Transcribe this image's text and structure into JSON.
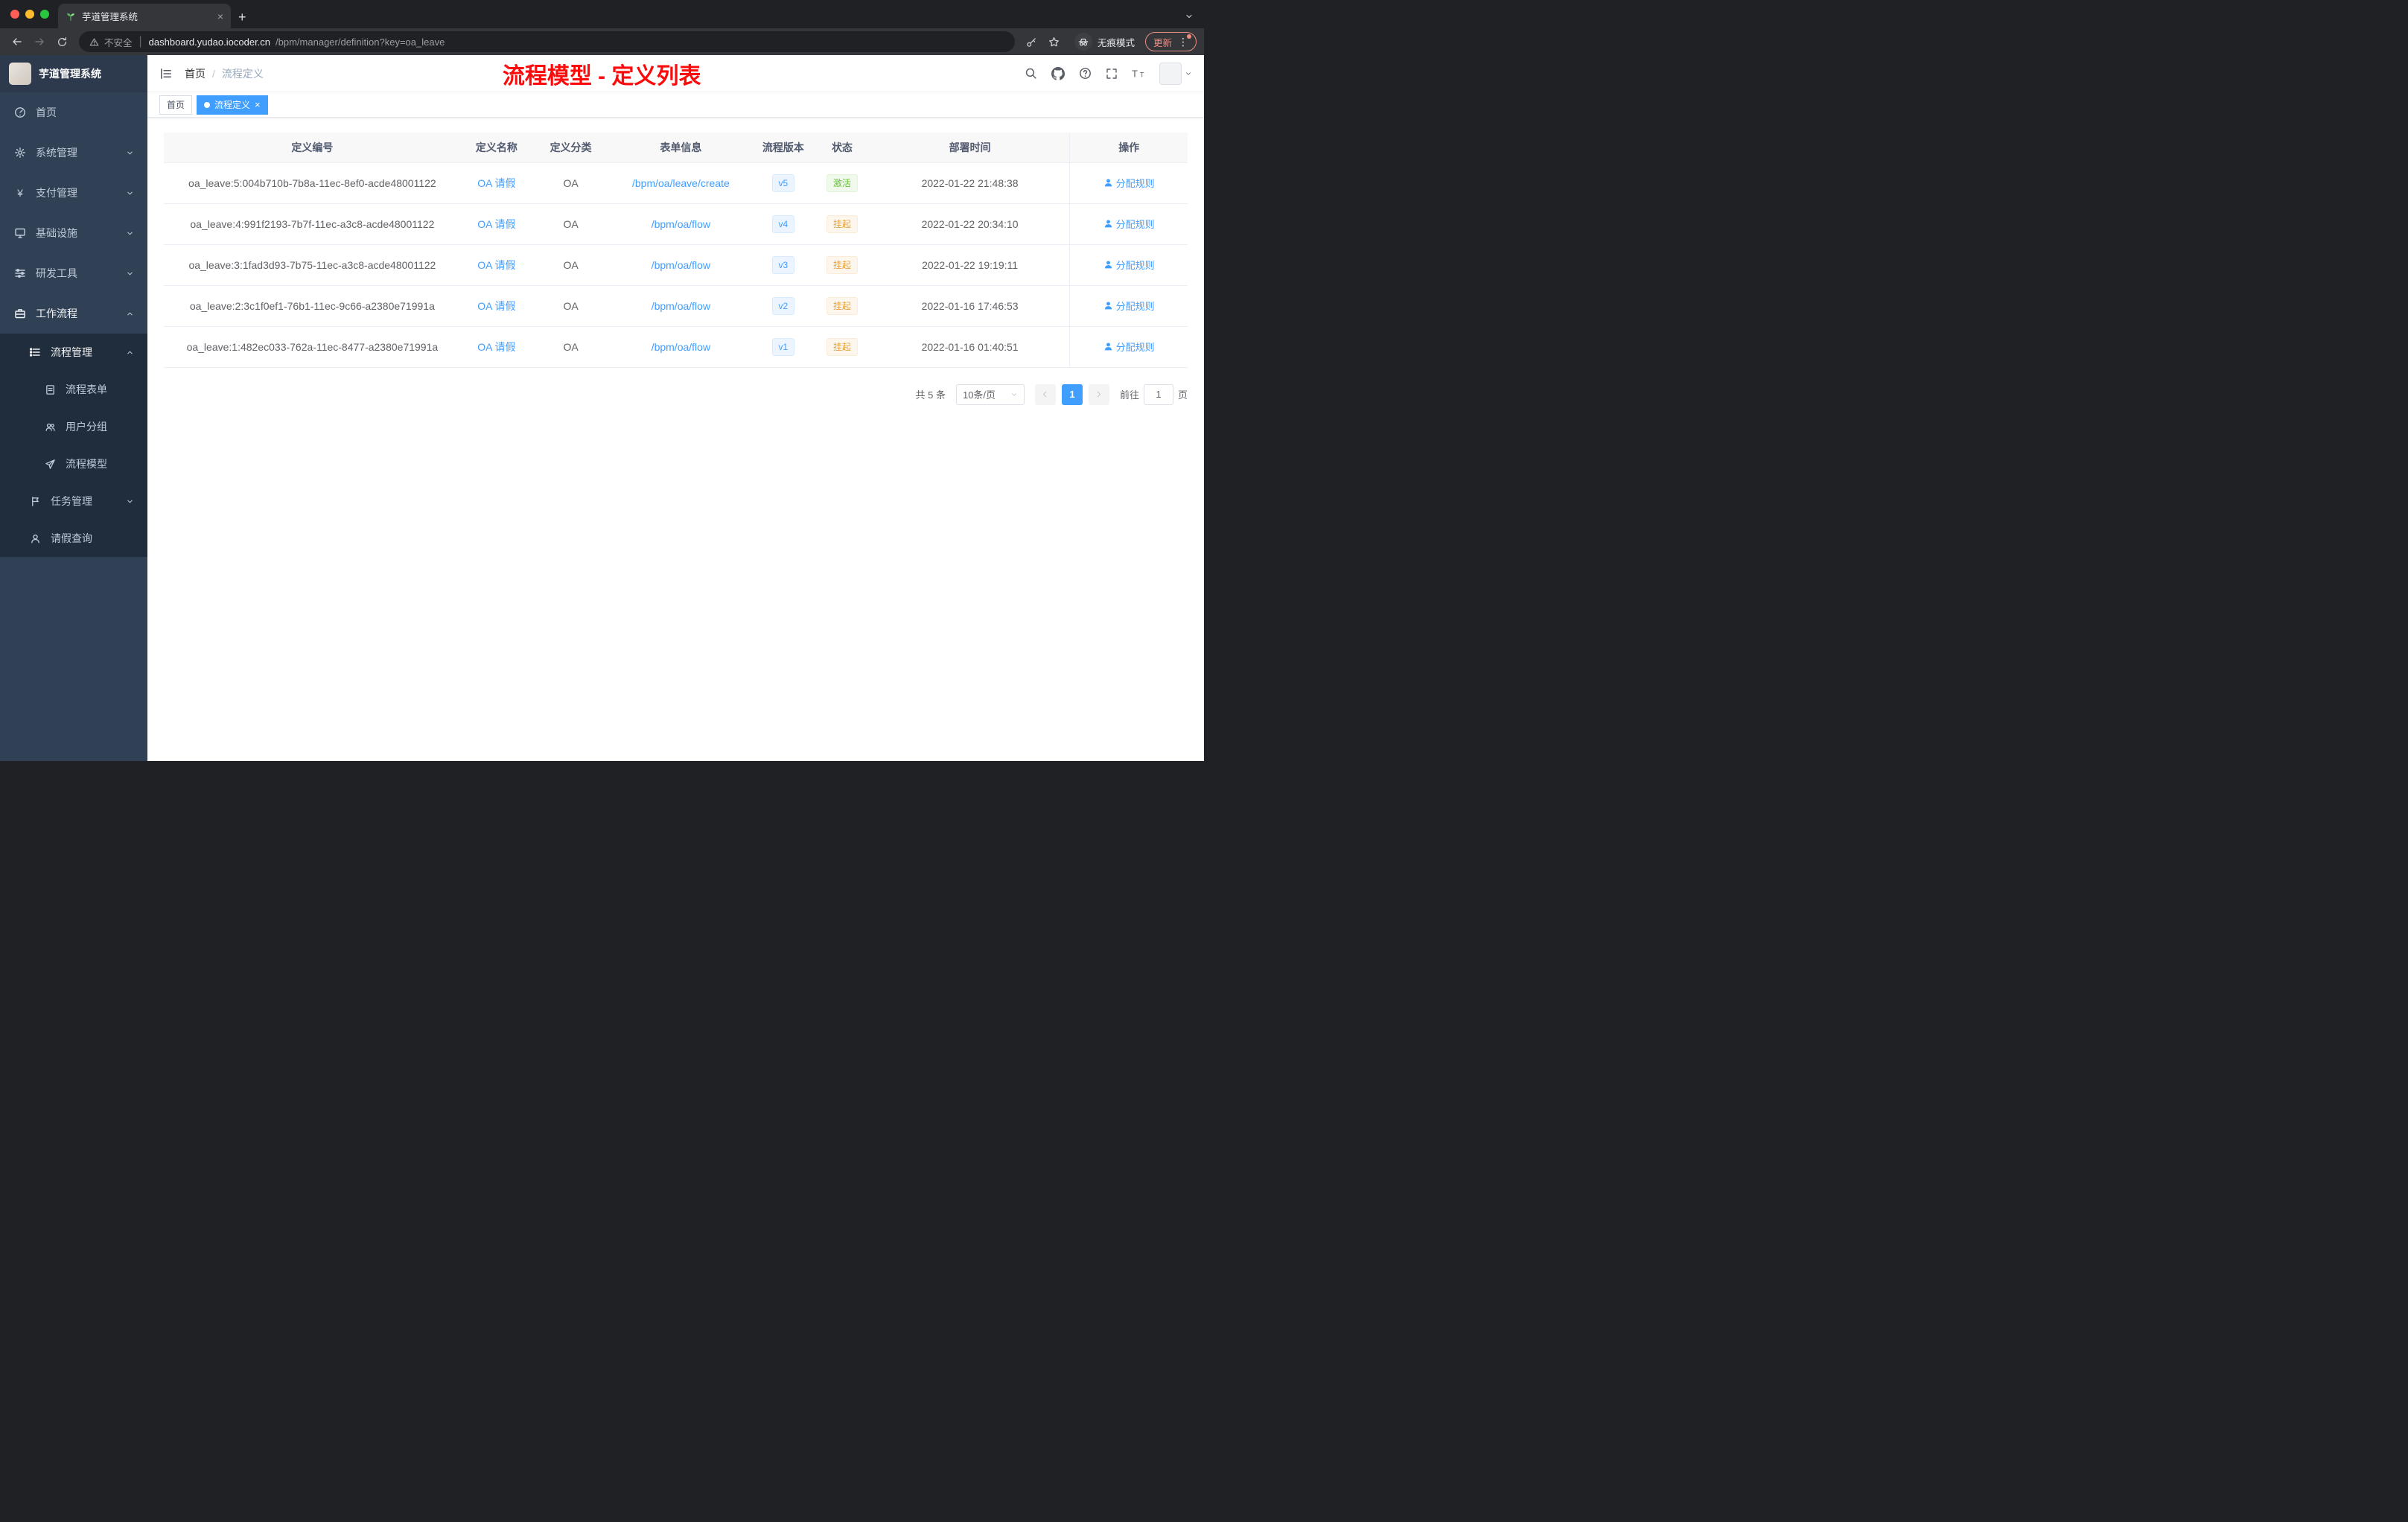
{
  "colors": {
    "accent": "#409eff",
    "annotation_red": "#fb0b0b",
    "sidebar_bg": "#304156",
    "submenu_bg": "#1f2d3d",
    "status_active_text": "#67c23a",
    "status_active_bg": "#f0f9eb",
    "status_suspended_text": "#e6a23c",
    "status_suspended_bg": "#fdf6ec",
    "version_text": "#409eff",
    "version_bg": "#ecf5ff"
  },
  "browser": {
    "tab_title": "芋道管理系统",
    "security_label": "不安全",
    "url_host": "dashboard.yudao.iocoder.cn",
    "url_path": "/bpm/manager/definition?key=oa_leave",
    "incognito_label": "无痕模式",
    "update_label": "更新"
  },
  "sidebar": {
    "title": "芋道管理系统",
    "items": [
      {
        "label": "首页",
        "icon": "dashboard-icon",
        "level": 1
      },
      {
        "label": "系统管理",
        "icon": "gear-icon",
        "level": 1,
        "chevron": "down"
      },
      {
        "label": "支付管理",
        "icon": "yen-icon",
        "level": 1,
        "chevron": "down"
      },
      {
        "label": "基础设施",
        "icon": "infrastructure-icon",
        "level": 1,
        "chevron": "down"
      },
      {
        "label": "研发工具",
        "icon": "dev-tools-icon",
        "level": 1,
        "chevron": "down"
      },
      {
        "label": "工作流程",
        "icon": "workflow-icon",
        "level": 1,
        "chevron": "up"
      },
      {
        "label": "流程管理",
        "icon": "process-manage-icon",
        "level": 2,
        "chevron": "up"
      },
      {
        "label": "流程表单",
        "icon": "form-icon",
        "level": 3
      },
      {
        "label": "用户分组",
        "icon": "user-group-icon",
        "level": 3
      },
      {
        "label": "流程模型",
        "icon": "process-model-icon",
        "level": 3
      },
      {
        "label": "任务管理",
        "icon": "task-icon",
        "level": 2,
        "chevron": "down"
      },
      {
        "label": "请假查询",
        "icon": "person-icon",
        "level": 2
      }
    ]
  },
  "header": {
    "breadcrumb": [
      "首页",
      "流程定义"
    ],
    "annotation": "流程模型 - 定义列表"
  },
  "tags": [
    {
      "label": "首页",
      "active": false
    },
    {
      "label": "流程定义",
      "active": true
    }
  ],
  "table": {
    "columns": [
      "定义编号",
      "定义名称",
      "定义分类",
      "表单信息",
      "流程版本",
      "状态",
      "部署时间",
      "操作"
    ],
    "rows": [
      {
        "id": "oa_leave:5:004b710b-7b8a-11ec-8ef0-acde48001122",
        "name": "OA 请假",
        "category": "OA",
        "form": "/bpm/oa/leave/create",
        "version": "v5",
        "status": "激活",
        "status_type": "active",
        "time": "2022-01-22 21:48:38",
        "action": "分配规则"
      },
      {
        "id": "oa_leave:4:991f2193-7b7f-11ec-a3c8-acde48001122",
        "name": "OA 请假",
        "category": "OA",
        "form": "/bpm/oa/flow",
        "version": "v4",
        "status": "挂起",
        "status_type": "suspended",
        "time": "2022-01-22 20:34:10",
        "action": "分配规则"
      },
      {
        "id": "oa_leave:3:1fad3d93-7b75-11ec-a3c8-acde48001122",
        "name": "OA 请假",
        "category": "OA",
        "form": "/bpm/oa/flow",
        "version": "v3",
        "status": "挂起",
        "status_type": "suspended",
        "time": "2022-01-22 19:19:11",
        "action": "分配规则"
      },
      {
        "id": "oa_leave:2:3c1f0ef1-76b1-11ec-9c66-a2380e71991a",
        "name": "OA 请假",
        "category": "OA",
        "form": "/bpm/oa/flow",
        "version": "v2",
        "status": "挂起",
        "status_type": "suspended",
        "time": "2022-01-16 17:46:53",
        "action": "分配规则"
      },
      {
        "id": "oa_leave:1:482ec033-762a-11ec-8477-a2380e71991a",
        "name": "OA 请假",
        "category": "OA",
        "form": "/bpm/oa/flow",
        "version": "v1",
        "status": "挂起",
        "status_type": "suspended",
        "time": "2022-01-16 01:40:51",
        "action": "分配规则"
      }
    ]
  },
  "pagination": {
    "total": "共 5 条",
    "page_size": "10条/页",
    "current_page": "1",
    "goto_label": "前往",
    "goto_value": "1",
    "page_unit": "页"
  }
}
